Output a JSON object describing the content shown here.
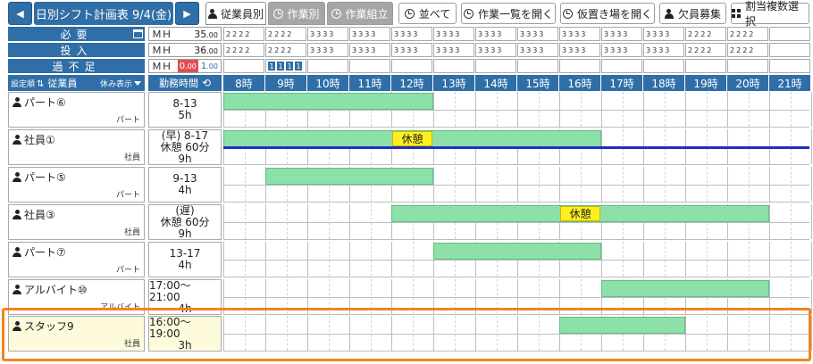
{
  "toolbar": {
    "prev_icon": "triangle-left-icon",
    "title": "日別シフト計画表 9/4(金)",
    "next_icon": "triangle-right-icon",
    "tabs": [
      {
        "label": "従業員別",
        "icon": "person-icon",
        "active": true
      },
      {
        "label": "作業別",
        "icon": "clock-icon",
        "active": false
      },
      {
        "label": "作業組立",
        "icon": "clock-icon",
        "active": false
      }
    ],
    "buttons": [
      {
        "label": "並べて",
        "icon": "clock-icon"
      },
      {
        "label": "作業一覧を開く",
        "icon": "clock-icon"
      },
      {
        "label": "仮置き場を開く",
        "icon": "clock-icon"
      },
      {
        "label": "欠員募集",
        "icon": "person-icon"
      },
      {
        "label": "割当複数選択",
        "icon": "grid-icon"
      }
    ]
  },
  "summary": {
    "required": {
      "label": "必要",
      "mh_label": "ＭＨ",
      "mh_value": "35",
      "mh_decimal": ".00",
      "cells": [
        "2 2 2 2",
        "2 2 2 2",
        "3 3 3 3",
        "3 3 3 3",
        "3 3 3 3",
        "3 3 3 3",
        "3 3 3 3",
        "3 3 3 3",
        "3 3 3 3",
        "3 3 3 3",
        "3 3 3 3",
        "2 2 2 2",
        "2 2 2 2",
        ""
      ]
    },
    "input": {
      "label": "投入",
      "mh_label": "ＭＨ",
      "mh_value": "36",
      "mh_decimal": ".00",
      "cells": [
        "2 2 2 2",
        "2 2 2 2",
        "3 3 3 3",
        "3 3 3 3",
        "3 3 3 3",
        "3 3 3 3",
        "3 3 3 3",
        "3 3 3 3",
        "3 3 3 3",
        "3 3 3 3",
        "3 3 3 3",
        "2 2 2 2",
        "2 2 2 2",
        ""
      ]
    },
    "diff": {
      "label": "過不足",
      "mh_label": "ＭＨ",
      "shortage_value": "0",
      "shortage_decimal": ".00",
      "surplus_value": "1",
      "surplus_decimal": ".00",
      "cells": [
        "",
        "1 1 1 1",
        "",
        "",
        "",
        "",
        "",
        "",
        "",
        "",
        "",
        "",
        "",
        ""
      ]
    }
  },
  "header": {
    "sort_label": "設定順",
    "employee_label": "従業員",
    "break_toggle_label": "休み表示",
    "work_hours_label": "勤務時間",
    "hours": [
      "8時",
      "9時",
      "10時",
      "11時",
      "12時",
      "13時",
      "14時",
      "15時",
      "16時",
      "17時",
      "18時",
      "19時",
      "20時",
      "21時"
    ]
  },
  "employees": [
    {
      "name": "パート⑥",
      "role": "パート",
      "shift_lines": [
        "8-13",
        "5h"
      ],
      "start": 8,
      "end": 13,
      "breaks": []
    },
    {
      "name": "社員①",
      "role": "社員",
      "shift_lines": [
        "(早) 8-17",
        "休憩 60分",
        "9h"
      ],
      "start": 8,
      "end": 17,
      "breaks": [
        {
          "label": "休憩",
          "start": 12,
          "end": 13
        }
      ]
    },
    {
      "name": "パート⑤",
      "role": "パート",
      "shift_lines": [
        "9-13",
        "4h"
      ],
      "start": 9,
      "end": 13,
      "breaks": []
    },
    {
      "name": "社員③",
      "role": "社員",
      "shift_lines": [
        "(遅)",
        "休憩 60分",
        "9h"
      ],
      "start": 12,
      "end": 21,
      "breaks": [
        {
          "label": "休憩",
          "start": 16,
          "end": 17
        }
      ]
    },
    {
      "name": "パート⑦",
      "role": "パート",
      "shift_lines": [
        "13-17",
        "4h"
      ],
      "start": 13,
      "end": 17,
      "breaks": []
    },
    {
      "name": "アルバイト⑩",
      "role": "アルバイト",
      "shift_lines": [
        "17:00～21:00",
        "4h"
      ],
      "start": 17,
      "end": 21,
      "breaks": []
    },
    {
      "name": "スタッフ9",
      "role": "社員",
      "shift_lines": [
        "16:00～19:00",
        "3h"
      ],
      "start": 16,
      "end": 19,
      "breaks": [],
      "highlighted": true
    }
  ],
  "colors": {
    "header_blue": "#2f6ea6",
    "shift_green": "#8ce0a8",
    "break_yellow": "#ffee20",
    "highlight_orange": "#f2861e",
    "now_line": "#1f2fc4",
    "shortage_red": "#e05050"
  }
}
